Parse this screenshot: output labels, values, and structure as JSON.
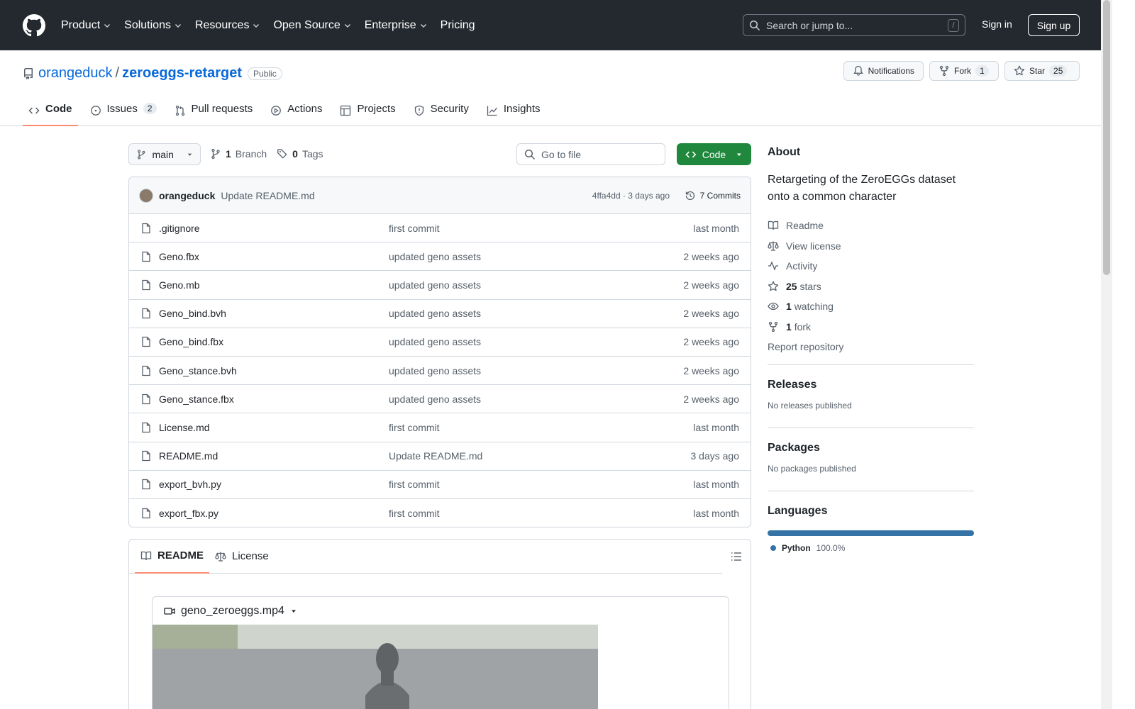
{
  "header": {
    "nav": [
      {
        "label": "Product",
        "dropdown": true
      },
      {
        "label": "Solutions",
        "dropdown": true
      },
      {
        "label": "Resources",
        "dropdown": true
      },
      {
        "label": "Open Source",
        "dropdown": true
      },
      {
        "label": "Enterprise",
        "dropdown": true
      },
      {
        "label": "Pricing",
        "dropdown": false
      }
    ],
    "search_placeholder": "Search or jump to...",
    "search_key": "/",
    "signin": "Sign in",
    "signup": "Sign up"
  },
  "repo": {
    "owner": "orangeduck",
    "separator": "/",
    "name": "zeroeggs-retarget",
    "visibility": "Public",
    "notifications": "Notifications",
    "fork_label": "Fork",
    "fork_count": "1",
    "star_label": "Star",
    "star_count": "25"
  },
  "tabs": [
    {
      "label": "Code",
      "icon": "code-icon",
      "active": true,
      "count": ""
    },
    {
      "label": "Issues",
      "icon": "issue-icon",
      "active": false,
      "count": "2"
    },
    {
      "label": "Pull requests",
      "icon": "pull-request-icon",
      "active": false,
      "count": ""
    },
    {
      "label": "Actions",
      "icon": "play-icon",
      "active": false,
      "count": ""
    },
    {
      "label": "Projects",
      "icon": "table-icon",
      "active": false,
      "count": ""
    },
    {
      "label": "Security",
      "icon": "shield-icon",
      "active": false,
      "count": ""
    },
    {
      "label": "Insights",
      "icon": "graph-icon",
      "active": false,
      "count": ""
    }
  ],
  "branchbar": {
    "branch": "main",
    "branch_count": "1",
    "branch_word": "Branch",
    "tag_count": "0",
    "tag_word": "Tags",
    "goto_placeholder": "Go to file",
    "code_button": "Code"
  },
  "commit": {
    "author": "orangeduck",
    "message": "Update README.md",
    "meta": "4ffa4dd · 3 days ago",
    "count_label": "7 Commits"
  },
  "files": [
    {
      "name": ".gitignore",
      "message": "first commit",
      "date": "last month"
    },
    {
      "name": "Geno.fbx",
      "message": "updated geno assets",
      "date": "2 weeks ago"
    },
    {
      "name": "Geno.mb",
      "message": "updated geno assets",
      "date": "2 weeks ago"
    },
    {
      "name": "Geno_bind.bvh",
      "message": "updated geno assets",
      "date": "2 weeks ago"
    },
    {
      "name": "Geno_bind.fbx",
      "message": "updated geno assets",
      "date": "2 weeks ago"
    },
    {
      "name": "Geno_stance.bvh",
      "message": "updated geno assets",
      "date": "2 weeks ago"
    },
    {
      "name": "Geno_stance.fbx",
      "message": "updated geno assets",
      "date": "2 weeks ago"
    },
    {
      "name": "License.md",
      "message": "first commit",
      "date": "last month"
    },
    {
      "name": "README.md",
      "message": "Update README.md",
      "date": "3 days ago"
    },
    {
      "name": "export_bvh.py",
      "message": "first commit",
      "date": "last month"
    },
    {
      "name": "export_fbx.py",
      "message": "first commit",
      "date": "last month"
    }
  ],
  "readme": {
    "tab_readme": "README",
    "tab_license": "License",
    "video_name": "geno_zeroeggs.mp4"
  },
  "about": {
    "heading": "About",
    "description": "Retargeting of the ZeroEGGs dataset onto a common character",
    "readme": "Readme",
    "license": "View license",
    "activity": "Activity",
    "stars_count": "25",
    "stars_word": "stars",
    "watching_count": "1",
    "watching_word": "watching",
    "fork_count": "1",
    "fork_word": "fork",
    "report": "Report repository"
  },
  "releases": {
    "heading": "Releases",
    "text": "No releases published"
  },
  "packages": {
    "heading": "Packages",
    "text": "No packages published"
  },
  "languages": {
    "heading": "Languages",
    "name": "Python",
    "percent": "100.0%",
    "color": "#3572a5"
  },
  "colors": {
    "header_bg": "#24292f",
    "link": "#0969da",
    "green": "#1f883d",
    "active_tab": "#fd8c73"
  }
}
